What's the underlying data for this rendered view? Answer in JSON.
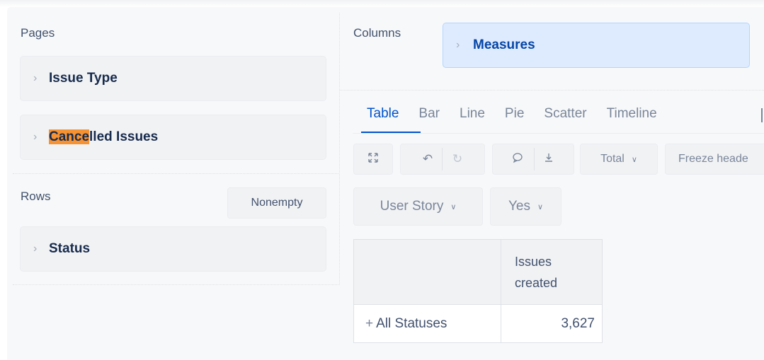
{
  "pages": {
    "label": "Pages",
    "items": [
      {
        "label": "Issue Type"
      },
      {
        "label_highlight": "Cance",
        "label_rest": "lled Issues"
      }
    ]
  },
  "rows": {
    "label": "Rows",
    "nonempty_label": "Nonempty",
    "items": [
      {
        "label": "Status"
      }
    ]
  },
  "columns": {
    "label": "Columns",
    "items": [
      {
        "label": "Measures"
      }
    ]
  },
  "tabs": [
    {
      "label": "Table",
      "active": true
    },
    {
      "label": "Bar"
    },
    {
      "label": "Line"
    },
    {
      "label": "Pie"
    },
    {
      "label": "Scatter"
    },
    {
      "label": "Timeline"
    }
  ],
  "toolbar": {
    "total_label": "Total",
    "freeze_label": "Freeze heade"
  },
  "filters": [
    {
      "label": "User Story"
    },
    {
      "label": "Yes"
    }
  ],
  "table": {
    "column_header_line1": "Issues",
    "column_header_line2": "created",
    "row_label": "All Statuses",
    "row_value": "3,627"
  },
  "colors": {
    "accent": "#0052cc",
    "highlight": "#f79233",
    "measures_chip_bg": "#deebff"
  }
}
